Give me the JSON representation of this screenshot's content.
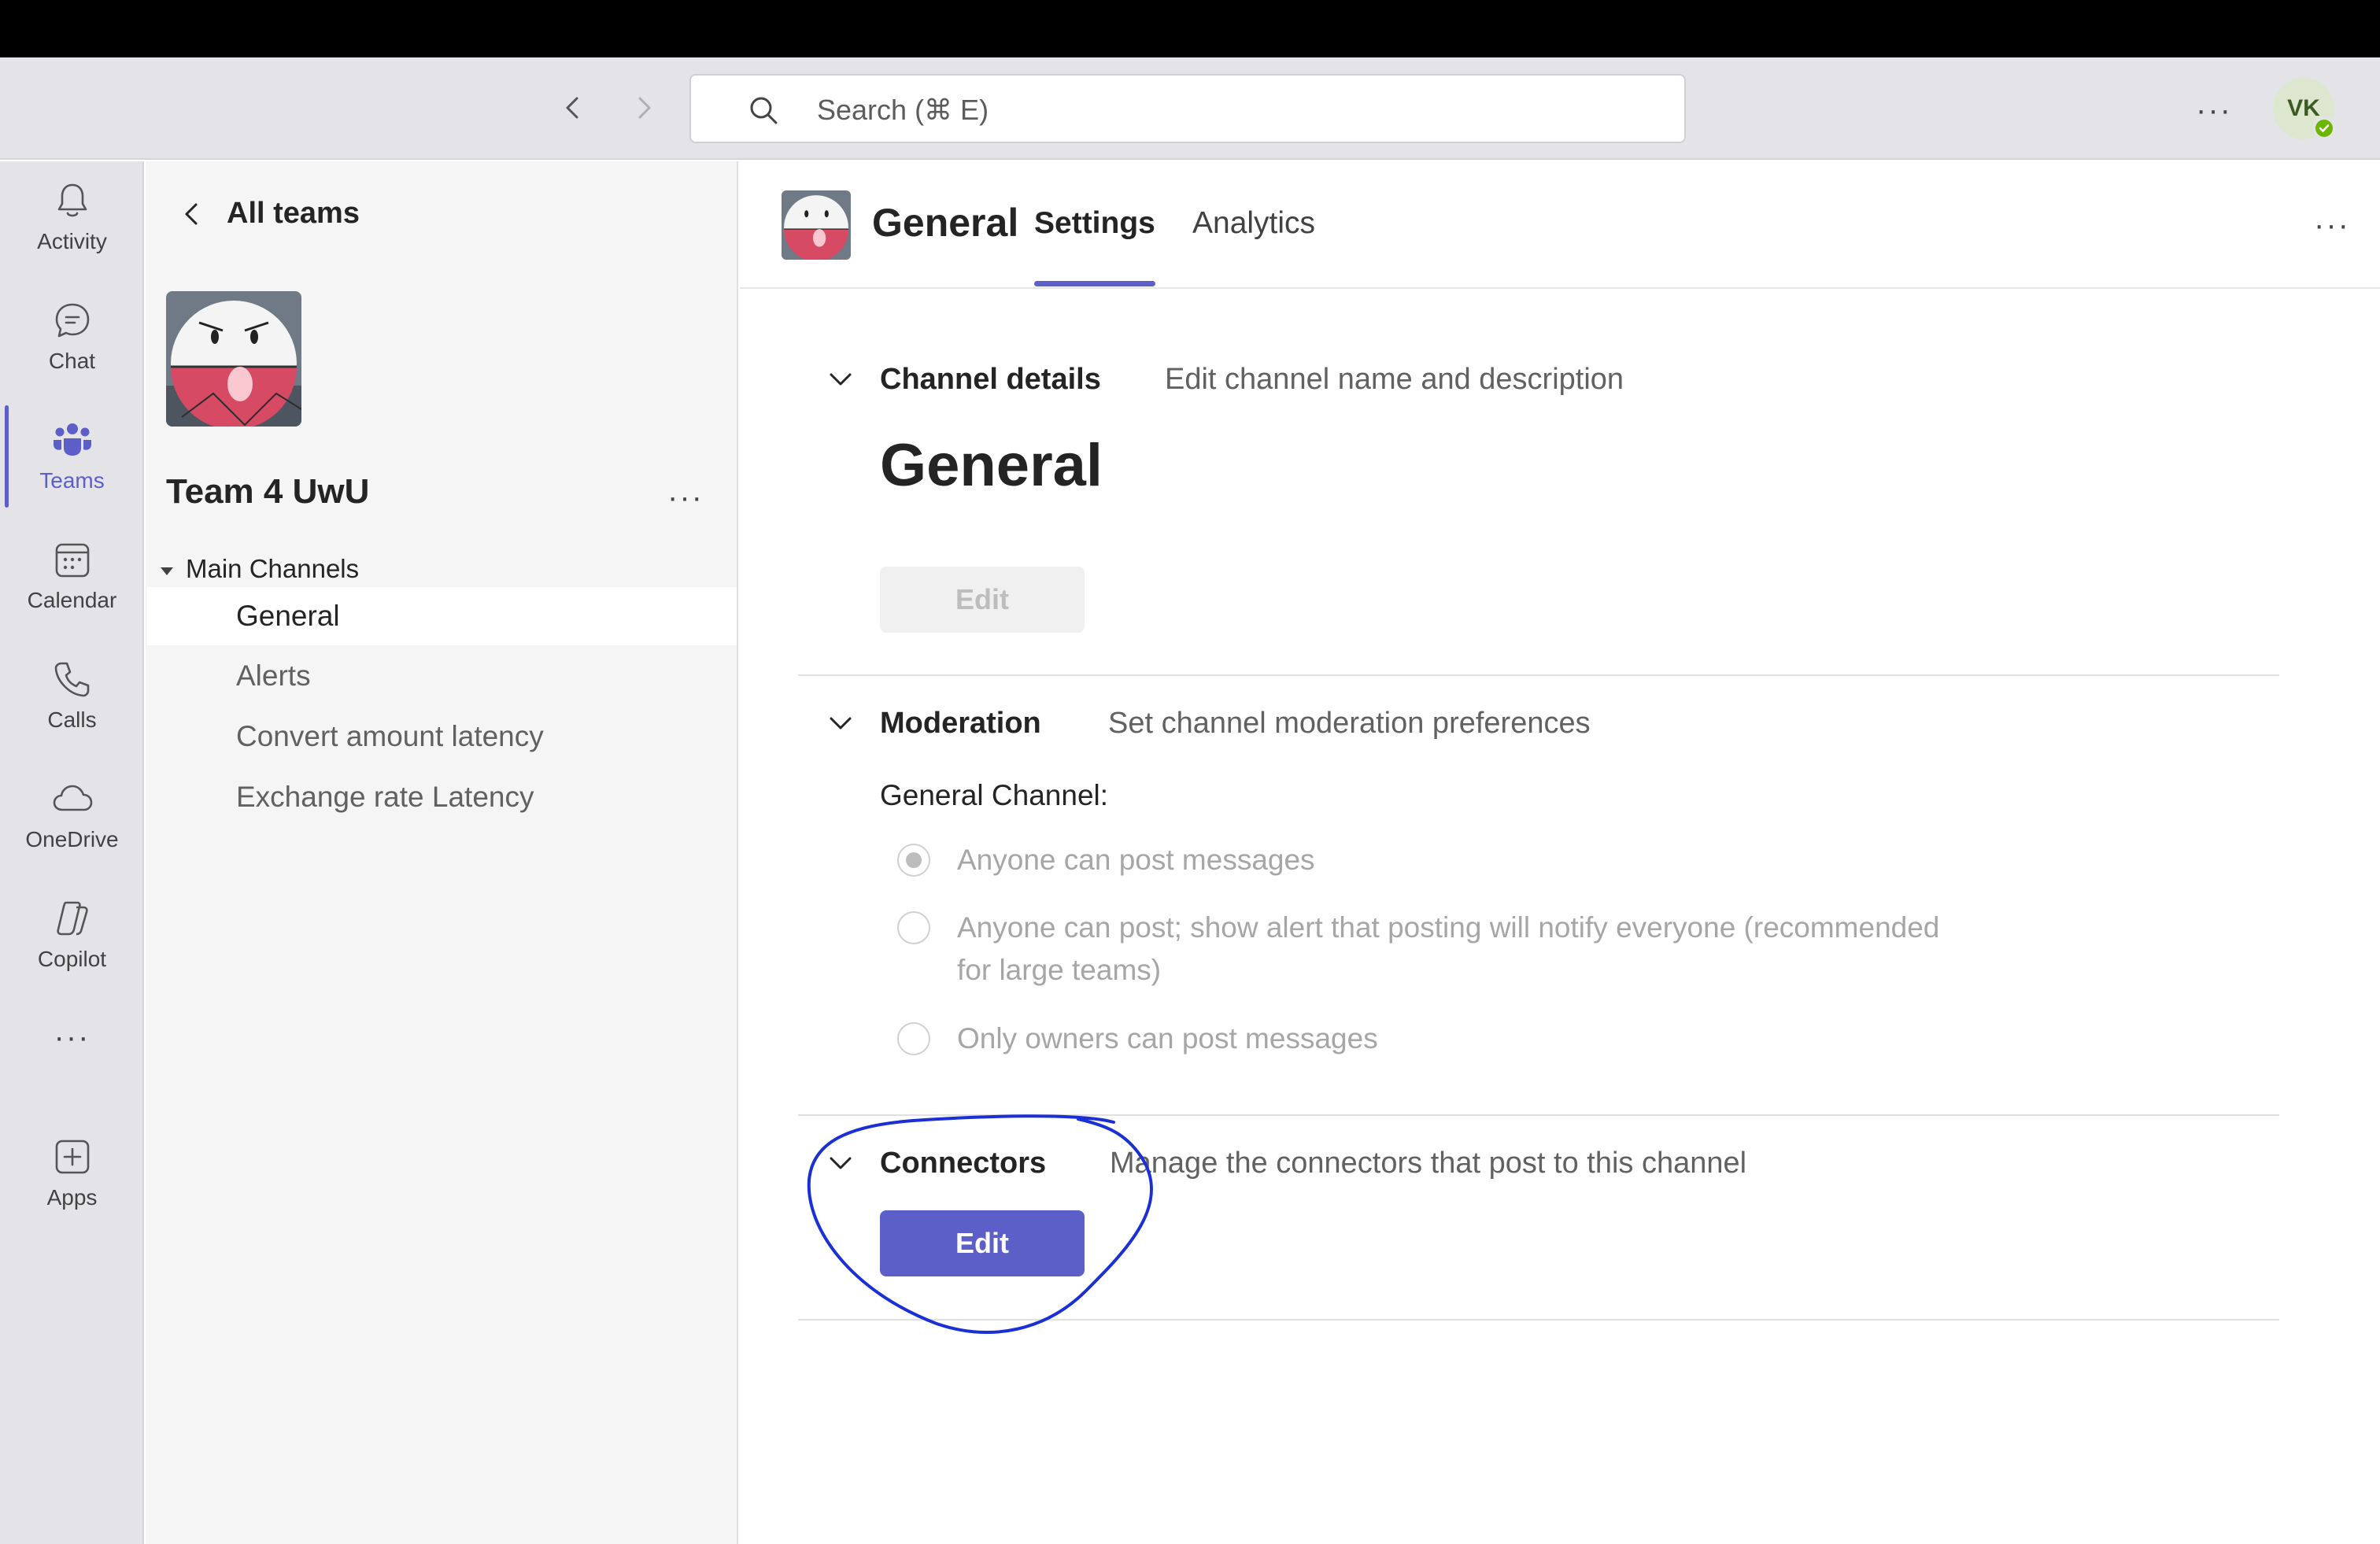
{
  "topbar": {
    "search_placeholder": "Search (⌘ E)",
    "more_label": "···",
    "avatar_initials": "VK",
    "status_color": "#6bb700"
  },
  "rail": {
    "items": [
      {
        "label": "Activity",
        "icon": "bell-icon"
      },
      {
        "label": "Chat",
        "icon": "chat-icon"
      },
      {
        "label": "Teams",
        "icon": "teams-icon",
        "active": true
      },
      {
        "label": "Calendar",
        "icon": "calendar-icon"
      },
      {
        "label": "Calls",
        "icon": "phone-icon"
      },
      {
        "label": "OneDrive",
        "icon": "cloud-icon"
      },
      {
        "label": "Copilot",
        "icon": "copilot-icon"
      }
    ],
    "more_label": "···",
    "apps_label": "Apps",
    "accent_color": "#5b5fc7"
  },
  "channels_pane": {
    "back_label": "All teams",
    "team_name": "Team 4 UwU",
    "team_more": "···",
    "group_label": "Main Channels",
    "channels": [
      "General",
      "Alerts",
      "Convert amount latency",
      "Exchange rate Latency"
    ],
    "selected": "General"
  },
  "main": {
    "channel_title": "General",
    "tabs": [
      "Settings",
      "Analytics"
    ],
    "active_tab": "Settings",
    "more_label": "···",
    "sections": {
      "channel_details": {
        "title": "Channel details",
        "description": "Edit channel name and description",
        "channel_name": "General",
        "edit_label": "Edit"
      },
      "moderation": {
        "title": "Moderation",
        "description": "Set channel moderation preferences",
        "sub_label": "General Channel:",
        "options": [
          "Anyone can post messages",
          "Anyone can post; show alert that posting will notify everyone (recommended",
          "for large teams)",
          "Only owners can post messages"
        ],
        "selected_option": "Anyone can post messages"
      },
      "connectors": {
        "title": "Connectors",
        "description": "Manage the connectors that post to this channel",
        "edit_label": "Edit"
      }
    },
    "annotation_color": "#1a2fd6"
  }
}
